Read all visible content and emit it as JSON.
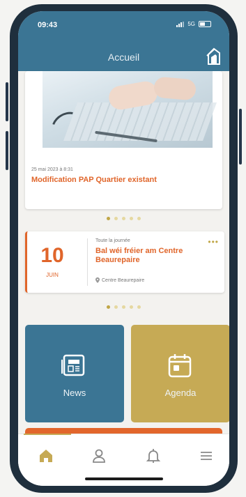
{
  "status_bar": {
    "time": "09:43",
    "network": "5G"
  },
  "header": {
    "title": "Accueil"
  },
  "news_card": {
    "date": "25 mai 2023 à 8:31",
    "title": "Modification PAP Quartier existant"
  },
  "event_card": {
    "day": "10",
    "month": "JUIN",
    "all_day": "Toute la journée",
    "title": "Bal wéi fréier am Centre Beaurepaire",
    "location": "Centre Beaurepaire",
    "more": "•••"
  },
  "tiles": {
    "news_label": "News",
    "agenda_label": "Agenda"
  },
  "carousel_news": {
    "count": 5,
    "active_index": 0
  },
  "carousel_events": {
    "count": 5,
    "active_index": 0
  },
  "colors": {
    "primary_blue": "#3b7594",
    "accent_orange": "#e0652a",
    "accent_gold": "#c6aa55"
  },
  "icons": {
    "nav": [
      "home-icon",
      "user-icon",
      "bell-icon",
      "menu-icon"
    ],
    "tiles": [
      "newspaper-icon",
      "calendar-icon"
    ]
  }
}
